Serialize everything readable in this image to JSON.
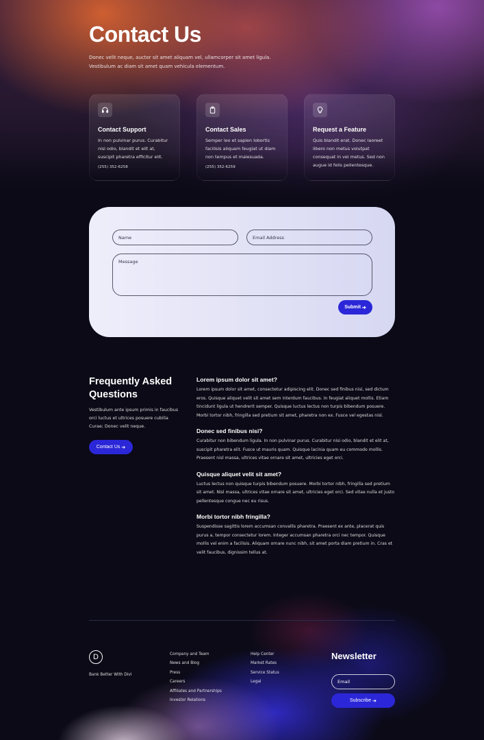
{
  "hero": {
    "title": "Contact Us",
    "subtitle": "Donec velit neque, auctor sit amet aliquam vel, ullamcorper sit amet ligula. Vestibulum ac diam sit amet quam vehicula elementum."
  },
  "cards": [
    {
      "icon": "headphones-icon",
      "title": "Contact Support",
      "text": "In non pulvinar purus. Curabitur nisi odio, blandit et elit at, suscipit pharetra efficitur elit.",
      "phone": "(255) 352-6258"
    },
    {
      "icon": "clipboard-icon",
      "title": "Contact Sales",
      "text": "Semper leo et sapien lobortis facilisis aliquam feugiat ut diam non tempus et malesuada.",
      "phone": "(255) 352-6259"
    },
    {
      "icon": "lightbulb-icon",
      "title": "Request a Feature",
      "text": "Quis blandit erat. Donec laoreet libero non metus volutpat consequat in vel metus. Sed non augue id felis pellentesque."
    }
  ],
  "form": {
    "name_placeholder": "Name",
    "email_placeholder": "Email Address",
    "message_placeholder": "Message",
    "submit_label": "Submit",
    "accent": "#2b27d8"
  },
  "faq": {
    "title": "Frequently Asked Questions",
    "intro": "Vestibulum ante ipsum primis in faucibus orci luctus et ultrices posuere cubilia Curae; Donec velit neque.",
    "button_label": "Contact Us",
    "items": [
      {
        "question": "Lorem ipsum dolor sit amet?",
        "answer": "Lorem ipsum dolor sit amet, consectetur adipiscing elit. Donec sed finibus nisi, sed dictum eros. Quisque aliquet velit sit amet sem interdum faucibus. In feugiat aliquet mollis. Etiam tincidunt ligula ut hendrerit semper. Quisque luctus lectus non turpis bibendum posuere. Morbi tortor nibh, fringilla sed pretium sit amet, pharetra non ex. Fusce vel egestas nisl."
      },
      {
        "question": "Donec sed finibus nisi?",
        "answer": "Curabitur non bibendum ligula. In non pulvinar purus. Curabitur nisi odio, blandit et elit at, suscipit pharetra elit. Fusce ut mauris quam. Quisque lacinia quam eu commodo mollis. Praesent nisl massa, ultrices vitae ornare sit amet, ultricies eget orci."
      },
      {
        "question": "Quisque aliquet velit sit amet?",
        "answer": "Luctus lectus non quisque turpis bibendum posuere. Morbi tortor nibh, fringilla sed pretium sit amet. Nisl massa, ultrices vitae ornare sit amet, ultricies eget orci. Sed vitae nulla et justo pellentesque congue nec eu risus."
      },
      {
        "question": "Morbi tortor nibh fringilla?",
        "answer": "Suspendisse sagittis lorem accumsan convallis pharetra. Praesent ex ante, placerat quis purus a, tempor consectetur lorem. Integer accumsan pharetra orci nec tempor. Quisque mollis vel enim a facilisis. Aliquam ornare nunc nibh, sit amet porta diam pretium in. Cras et velit faucibus, dignissim tellus at."
      }
    ]
  },
  "footer": {
    "logo_letter": "D",
    "tagline": "Bank Better With Divi",
    "links_col1": [
      "Company and Team",
      "News and Blog",
      "Press",
      "Careers",
      "Affiliates and Partnerships",
      "Investor Relations"
    ],
    "links_col2": [
      "Help Center",
      "Market Rates",
      "Service Status",
      "Legal"
    ],
    "newsletter_title": "Newsletter",
    "email_placeholder": "Email",
    "subscribe_label": "Subscribe"
  },
  "arrow_glyph": "➔"
}
